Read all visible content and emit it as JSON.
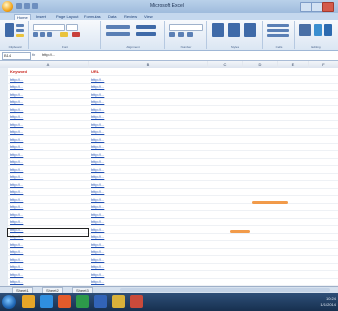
{
  "window": {
    "title": "Microsoft Excel"
  },
  "ribbon": {
    "tabs": [
      "Home",
      "Insert",
      "Page Layout",
      "Formulas",
      "Data",
      "Review",
      "View"
    ],
    "groups": [
      "Clipboard",
      "Font",
      "Alignment",
      "Number",
      "Styles",
      "Cells",
      "Editing"
    ]
  },
  "formula_bar": {
    "name_box": "B14",
    "fx": "fx",
    "value": "http://..."
  },
  "columns": [
    "A",
    "B",
    "C",
    "D",
    "E",
    "F"
  ],
  "sheet": {
    "header": [
      "Keyword",
      "URL"
    ],
    "rows": [
      [
        "http://...",
        "http://..."
      ],
      [
        "http://...",
        "http://..."
      ],
      [
        "http://...",
        "http://..."
      ],
      [
        "http://...",
        "http://..."
      ],
      [
        "http://...",
        "http://..."
      ],
      [
        "http://...",
        "http://..."
      ],
      [
        "http://...",
        "http://..."
      ],
      [
        "http://...",
        "http://..."
      ],
      [
        "http://...",
        "http://..."
      ],
      [
        "http://...",
        "http://..."
      ],
      [
        "http://...",
        "http://..."
      ],
      [
        "http://...",
        "http://..."
      ],
      [
        "http://...",
        "http://..."
      ],
      [
        "http://...",
        "http://..."
      ],
      [
        "http://...",
        "http://..."
      ],
      [
        "http://...",
        "http://..."
      ],
      [
        "http://...",
        "http://..."
      ],
      [
        "http://...",
        "http://..."
      ],
      [
        "http://...",
        "http://..."
      ],
      [
        "http://...",
        "http://..."
      ],
      [
        "http://...",
        "http://..."
      ],
      [
        "http://...",
        "http://..."
      ],
      [
        "http://...",
        "http://..."
      ],
      [
        "http://...",
        "http://..."
      ],
      [
        "http://...",
        "http://..."
      ],
      [
        "http://...",
        "http://..."
      ],
      [
        "http://...",
        "http://..."
      ],
      [
        "http://...",
        "http://..."
      ],
      [
        "http://...",
        "http://..."
      ]
    ]
  },
  "sheet_tabs": [
    "Sheet1",
    "Sheet2",
    "Sheet3"
  ],
  "taskbar": {
    "apps": [
      "start-orb",
      "explorer",
      "ie",
      "media",
      "excel",
      "word",
      "folder",
      "chrome"
    ],
    "clock": "10:24",
    "date": "1/1/2014"
  },
  "colors": {
    "ribbon": "#dbe6f3",
    "link": "#1f4fb4",
    "header_text": "#c8241c",
    "taskbar": "#17304f"
  }
}
